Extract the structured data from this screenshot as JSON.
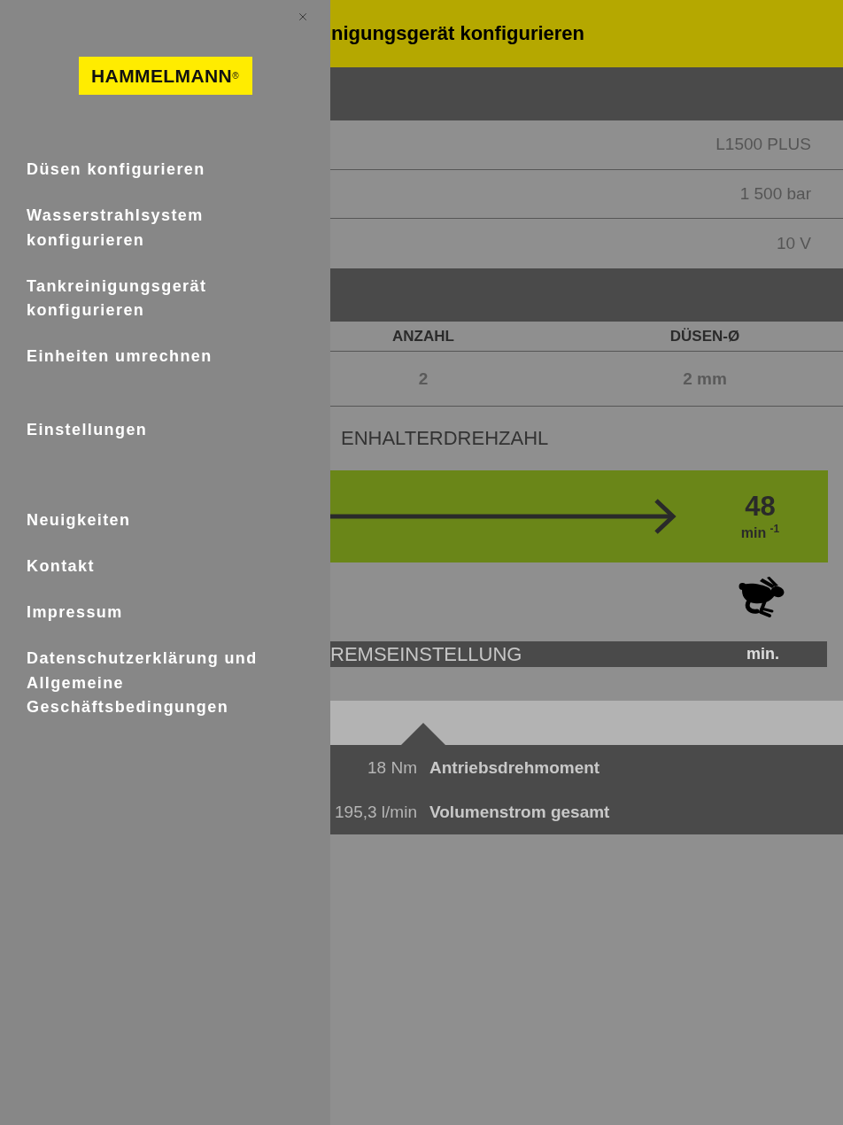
{
  "drawer": {
    "logo": "HAMMELMANN$^{®}$",
    "menu_sections": [
      {
        "items": [
          "Düsen konfigurieren",
          "Wasserstrahlsystem konfigurieren",
          "Tankreinigungsgerät konfigurieren",
          "Einheiten umrechnen"
        ]
      },
      {
        "items": [
          "Einstellungen"
        ]
      },
      {
        "items": [
          "Neuigkeiten",
          "Kontakt",
          "Impressum",
          "Datenschutzerklärung und Allgemeine Geschäftsbedingungen"
        ]
      }
    ]
  },
  "header": {
    "title": "nigungsgerät konfigurieren"
  },
  "specs": [
    {
      "value": "L1500 PLUS"
    },
    {
      "value": "1 500 bar"
    },
    {
      "value": "10 V"
    }
  ],
  "nozzle_table": {
    "columns": [
      "ANZAHL",
      "DÜSEN-Ø"
    ],
    "rows": [
      [
        "2",
        "2 mm"
      ]
    ]
  },
  "speed": {
    "heading": "ENHALTERDREHZAHL",
    "value": "48",
    "unit": "min $^{-1}$"
  },
  "brake": {
    "heading": "REMSEINSTELLUNG",
    "setting": "min."
  },
  "results": [
    {
      "value": "18 Nm",
      "label": "Antriebsdrehmoment"
    },
    {
      "value": "195,3 l/min",
      "label": "Volumenstrom gesamt"
    }
  ]
}
